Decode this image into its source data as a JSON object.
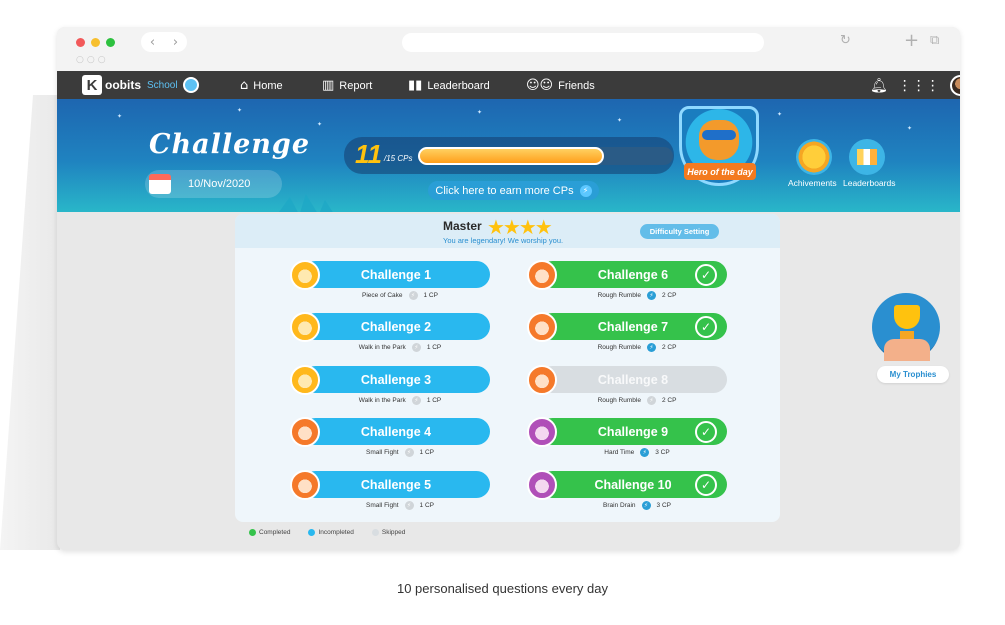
{
  "app": {
    "logo_brand": "oobits",
    "logo_letter": "K",
    "logo_school": "School"
  },
  "nav": {
    "items": [
      {
        "label": "Home",
        "icon": "home-icon",
        "glyph": "⌂"
      },
      {
        "label": "Report",
        "icon": "report-icon",
        "glyph": "▥"
      },
      {
        "label": "Leaderboard",
        "icon": "leaderboard-icon",
        "glyph": "▮▮"
      },
      {
        "label": "Friends",
        "icon": "friends-icon",
        "glyph": "☺☺"
      }
    ]
  },
  "banner": {
    "title": "Challenge",
    "date": "10/Nov/2020",
    "cp_current": "11",
    "cp_unit": "/15 CPs",
    "cp_progress": 0.73,
    "earn_label": "Click here to earn more CPs",
    "hero_label": "Hero of the day",
    "achievements_label": "Achivements",
    "leaderboards_label": "Leaderboards"
  },
  "level": {
    "name": "Master",
    "stars": 4,
    "subtitle": "You are legendary! We worship you.",
    "difficulty_label": "Difficulty Setting"
  },
  "challenges": [
    {
      "label": "Challenge 1",
      "desc": "Piece of Cake",
      "cp": "1 CP",
      "status": "incompleted",
      "face": "f-y"
    },
    {
      "label": "Challenge 2",
      "desc": "Walk in the Park",
      "cp": "1 CP",
      "status": "incompleted",
      "face": "f-y"
    },
    {
      "label": "Challenge 3",
      "desc": "Walk in the Park",
      "cp": "1 CP",
      "status": "incompleted",
      "face": "f-y"
    },
    {
      "label": "Challenge 4",
      "desc": "Small Fight",
      "cp": "1 CP",
      "status": "incompleted",
      "face": "f-o"
    },
    {
      "label": "Challenge 5",
      "desc": "Small Fight",
      "cp": "1 CP",
      "status": "incompleted",
      "face": "f-o"
    },
    {
      "label": "Challenge 6",
      "desc": "Rough Rumble",
      "cp": "2 CP",
      "status": "completed",
      "face": "f-o"
    },
    {
      "label": "Challenge 7",
      "desc": "Rough Rumble",
      "cp": "2 CP",
      "status": "completed",
      "face": "f-o"
    },
    {
      "label": "Challenge 8",
      "desc": "Rough Rumble",
      "cp": "2 CP",
      "status": "skipped",
      "face": "f-o"
    },
    {
      "label": "Challenge 9",
      "desc": "Hard Time",
      "cp": "3 CP",
      "status": "completed",
      "face": "f-p"
    },
    {
      "label": "Challenge 10",
      "desc": "Brain Drain",
      "cp": "3 CP",
      "status": "completed",
      "face": "f-p"
    }
  ],
  "legend": {
    "completed": "Completed",
    "incompleted": "Incompleted",
    "skipped": "Skipped"
  },
  "trophies_label": "My Trophies",
  "caption": "10 personalised questions every day",
  "colors": {
    "completed": "#35c24b",
    "incompleted": "#29b8ef",
    "skipped": "#d8dde1"
  }
}
